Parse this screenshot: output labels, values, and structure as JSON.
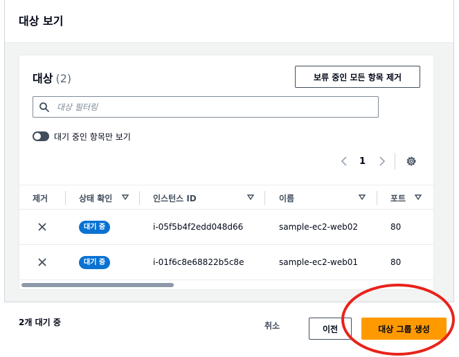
{
  "modal": {
    "title": "대상 보기"
  },
  "card": {
    "title": "대상",
    "count": "(2)",
    "remove_all_pending_label": "보류 중인 모든 항목 제거"
  },
  "filter": {
    "placeholder": "대상 필터링"
  },
  "toggle": {
    "label": "대기 중인 항목만 보기",
    "on": true
  },
  "pagination": {
    "current_page": "1"
  },
  "table": {
    "columns": [
      "제거",
      "상태 확인",
      "인스턴스 ID",
      "이름",
      "포트"
    ],
    "rows": [
      {
        "status": "대기 중",
        "instance_id": "i-05f5b4f2edd048d66",
        "name": "sample-ec2-web02",
        "port": "80"
      },
      {
        "status": "대기 중",
        "instance_id": "i-01f6c8e68822b5c8e",
        "name": "sample-ec2-web01",
        "port": "80"
      }
    ]
  },
  "footer": {
    "status_text": "2개 대기 중",
    "cancel_label": "취소",
    "previous_label": "이전",
    "create_label": "대상 그룹 생성"
  },
  "colors": {
    "primary_button": "#ff9900",
    "badge": "#0972d3",
    "annotation_circle": "#e8231b"
  }
}
